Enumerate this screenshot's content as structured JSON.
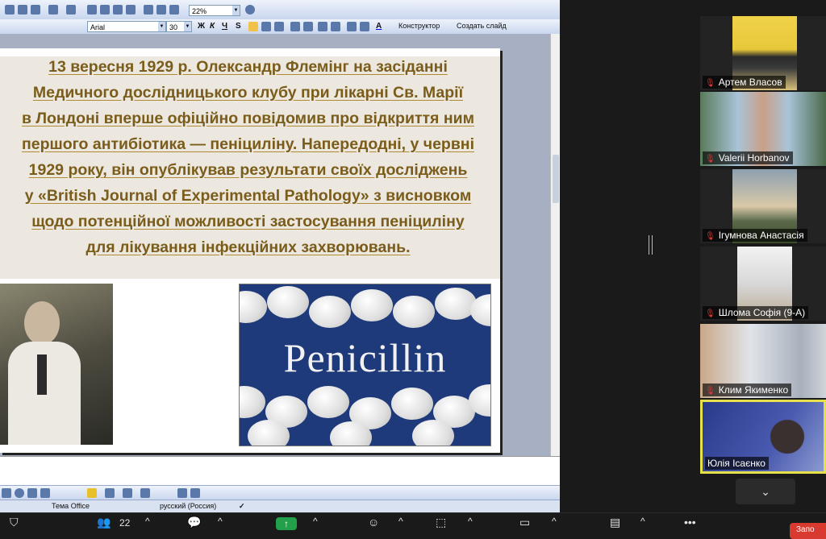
{
  "ppt": {
    "zoom": "22%",
    "font_name": "Arial",
    "font_size": "30",
    "bold": "Ж",
    "italic": "К",
    "underline": "Ч",
    "shadow": "S",
    "font_color_letter": "A",
    "designer_label": "Конструктор",
    "new_slide_label": "Создать слайд",
    "slide_lines": [
      "13 вересня 1929 р. Олександр Флемінг на засіданні",
      "Медичного дослідницького клубу при лікарні Св. Марії",
      "в Лондоні вперше офіційно повідомив про відкриття ним",
      "першого антибіотика — пеніциліну. Напередодні, у червні",
      "1929 року, він опублікував результати своїх досліджень",
      "у «British Journal of Experimental Pathology» з висновком",
      "щодо потенційної можливості застосування пеніциліну",
      "для лікування інфекційних захворювань."
    ],
    "image_word": "Penicillin",
    "status_theme": "Тема Office",
    "status_language": "русский (Россия)"
  },
  "participants": [
    {
      "name": "Артем Власов",
      "muted": true,
      "icon": "car-thumbnail"
    },
    {
      "name": "Valerii Horbanov",
      "muted": true,
      "icon": "man-glasses-thumbnail"
    },
    {
      "name": "Ігумнова Анастасія",
      "muted": true,
      "icon": "park-thumbnail"
    },
    {
      "name": "Шломa Софія (9-А)",
      "muted": true,
      "icon": "room-thumbnail"
    },
    {
      "name": "Клим Якименко",
      "muted": true,
      "icon": "car-wall-thumbnail"
    },
    {
      "name": "Юлія Ісаєнко",
      "muted": false,
      "icon": "woman-thumbnail"
    }
  ],
  "participants_count": "22",
  "record_label": "Запо",
  "colors": {
    "slide_text": "#7a5d1a",
    "slide_box": "#ece7df",
    "active_speaker": "#e6e14a",
    "share_green": "#23a04a",
    "muted_red": "#e03c3c"
  }
}
